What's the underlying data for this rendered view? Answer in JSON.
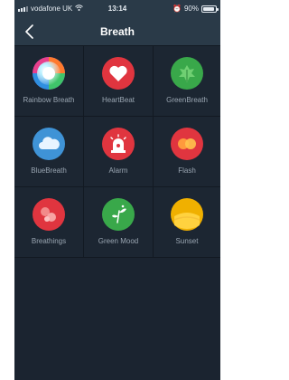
{
  "status": {
    "carrier": "vodafone UK",
    "time": "13:14",
    "alarm_glyph": "⏰",
    "battery_text": "90%",
    "battery_level": 0.9
  },
  "nav": {
    "title": "Breath",
    "back_icon": "chevron-left-icon"
  },
  "items": [
    {
      "label": "Rainbow Breath",
      "icon": "rainbow-icon",
      "color": "#ff6a3d"
    },
    {
      "label": "HeartBeat",
      "icon": "heart-icon",
      "color": "#e0353f"
    },
    {
      "label": "GreenBreath",
      "icon": "leaf-icon",
      "color": "#39a84a"
    },
    {
      "label": "BlueBreath",
      "icon": "cloud-icon",
      "color": "#3f93d6"
    },
    {
      "label": "Alarm",
      "icon": "siren-icon",
      "color": "#e0353f"
    },
    {
      "label": "Flash",
      "icon": "flash-icon",
      "color": "#e0353f"
    },
    {
      "label": "Breathings",
      "icon": "bubbles-icon",
      "color": "#e0353f"
    },
    {
      "label": "Green Mood",
      "icon": "sprout-icon",
      "color": "#39a84a"
    },
    {
      "label": "Sunset",
      "icon": "sunset-icon",
      "color": "#f0b000"
    }
  ]
}
